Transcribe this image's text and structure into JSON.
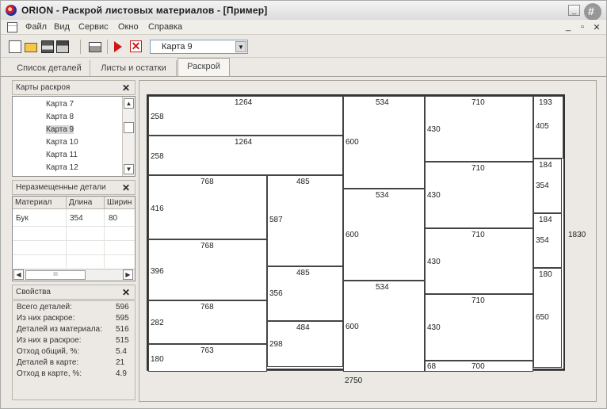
{
  "window": {
    "title": "ORION - Раскрой листовых материалов - [Пример]"
  },
  "menu": {
    "items": [
      "Файл",
      "Вид",
      "Сервис",
      "Окно",
      "Справка"
    ],
    "mdi_minimize": "_",
    "mdi_restore": "▫",
    "mdi_close": "✕"
  },
  "toolbar": {
    "map_select_value": "Карта 9",
    "dropdown_arrow": "▼"
  },
  "tabs": [
    {
      "label": "Список деталей",
      "active": false
    },
    {
      "label": "Листы и остатки",
      "active": false
    },
    {
      "label": "Раскрой",
      "active": true
    }
  ],
  "maps_panel": {
    "title": "Карты раскроя",
    "close": "✕",
    "items": [
      {
        "label": "Карта  7",
        "selected": false
      },
      {
        "label": "Карта  8",
        "selected": false
      },
      {
        "label": "Карта  9",
        "selected": true
      },
      {
        "label": "Карта  10",
        "selected": false
      },
      {
        "label": "Карта  11",
        "selected": false
      },
      {
        "label": "Карта  12",
        "selected": false
      }
    ],
    "scroll_up": "▲",
    "scroll_down": "▼"
  },
  "unplaced_panel": {
    "title": "Неразмещенные детали",
    "close": "✕",
    "columns": [
      "Материал",
      "Длина",
      "Ширин"
    ],
    "rows": [
      [
        "Бук",
        "354",
        "80"
      ]
    ],
    "scroll_left": "◀",
    "scroll_right": "▶",
    "scroll_thumb": "III"
  },
  "props_panel": {
    "title": "Свойства",
    "close": "✕",
    "rows": [
      {
        "label": "Всего деталей:",
        "value": "596"
      },
      {
        "label": "Из них раскроe:",
        "value": "595"
      },
      {
        "label": "Деталей из материала:",
        "value": "516"
      },
      {
        "label": "Из них в раскрое:",
        "value": "515"
      },
      {
        "label": "Отход общий, %:",
        "value": "5.4"
      },
      {
        "label": "Деталей в карте:",
        "value": "21"
      },
      {
        "label": "Отход в карте, %:",
        "value": "4.9"
      }
    ]
  },
  "cut_map": {
    "sheet_length": "2750",
    "sheet_width": "1830",
    "pieces": [
      {
        "w": "1264",
        "h": "258"
      },
      {
        "w": "1264",
        "h": "258"
      },
      {
        "w": "768",
        "h": "416"
      },
      {
        "w": "768",
        "h": "396"
      },
      {
        "w": "768",
        "h": "282"
      },
      {
        "w": "763",
        "h": "180"
      },
      {
        "w": "485",
        "h": "587"
      },
      {
        "w": "485",
        "h": "356"
      },
      {
        "w": "484",
        "h": "298"
      },
      {
        "w": "534",
        "h": "600"
      },
      {
        "w": "534",
        "h": "600"
      },
      {
        "w": "534",
        "h": "600"
      },
      {
        "w": "710",
        "h": "430"
      },
      {
        "w": "710",
        "h": "430"
      },
      {
        "w": "710",
        "h": "430"
      },
      {
        "w": "710",
        "h": "430"
      },
      {
        "w": "700",
        "h": "68"
      },
      {
        "w": "193",
        "h": "405"
      },
      {
        "w": "184",
        "h": "354"
      },
      {
        "w": "184",
        "h": "354"
      },
      {
        "w": "180",
        "h": "650"
      }
    ]
  }
}
